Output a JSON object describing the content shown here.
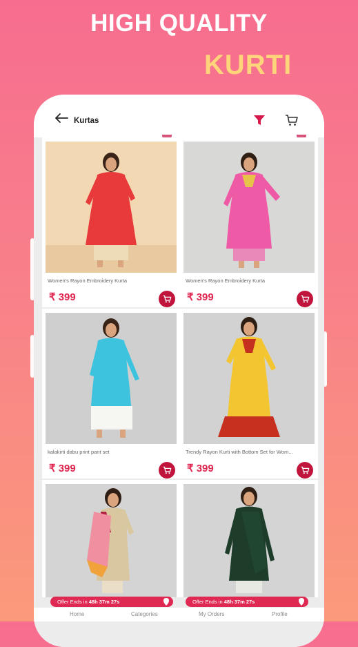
{
  "promo": {
    "headline_line1": "HIGH QUALITY",
    "headline_line2": "KURTI"
  },
  "appbar": {
    "title": "Kurtas",
    "icons": [
      "back-arrow-icon",
      "filter-icon",
      "cart-icon"
    ]
  },
  "products": [
    {
      "name": "Women's Rayon Embroidery Kurta",
      "price": "₹ 399",
      "dress_color": "#e83a3a"
    },
    {
      "name": "Women's Rayon Embroidery Kurta",
      "price": "₹ 399",
      "dress_color": "#ee5aa5"
    },
    {
      "name": "kalakirti dabu print pant set",
      "price": "₹ 399",
      "dress_color": "#3ec3df"
    },
    {
      "name": "Trendy Rayon Kurti with Bottom Set for Wom...",
      "price": "₹ 399",
      "dress_color": "#f2c531"
    },
    {
      "name": "",
      "price": "",
      "dress_color": "#d9c7a0"
    },
    {
      "name": "",
      "price": "",
      "dress_color": "#1d3d2a"
    }
  ],
  "offer": {
    "label": "Offer Ends in",
    "timer": "48h 37m 27s"
  },
  "bottom_nav": [
    "Home",
    "Categories",
    "My Orders",
    "Profile"
  ],
  "colors": {
    "accent": "#e0264f",
    "cart_button": "#c0143c",
    "headline_yellow": "#ffd47a"
  }
}
